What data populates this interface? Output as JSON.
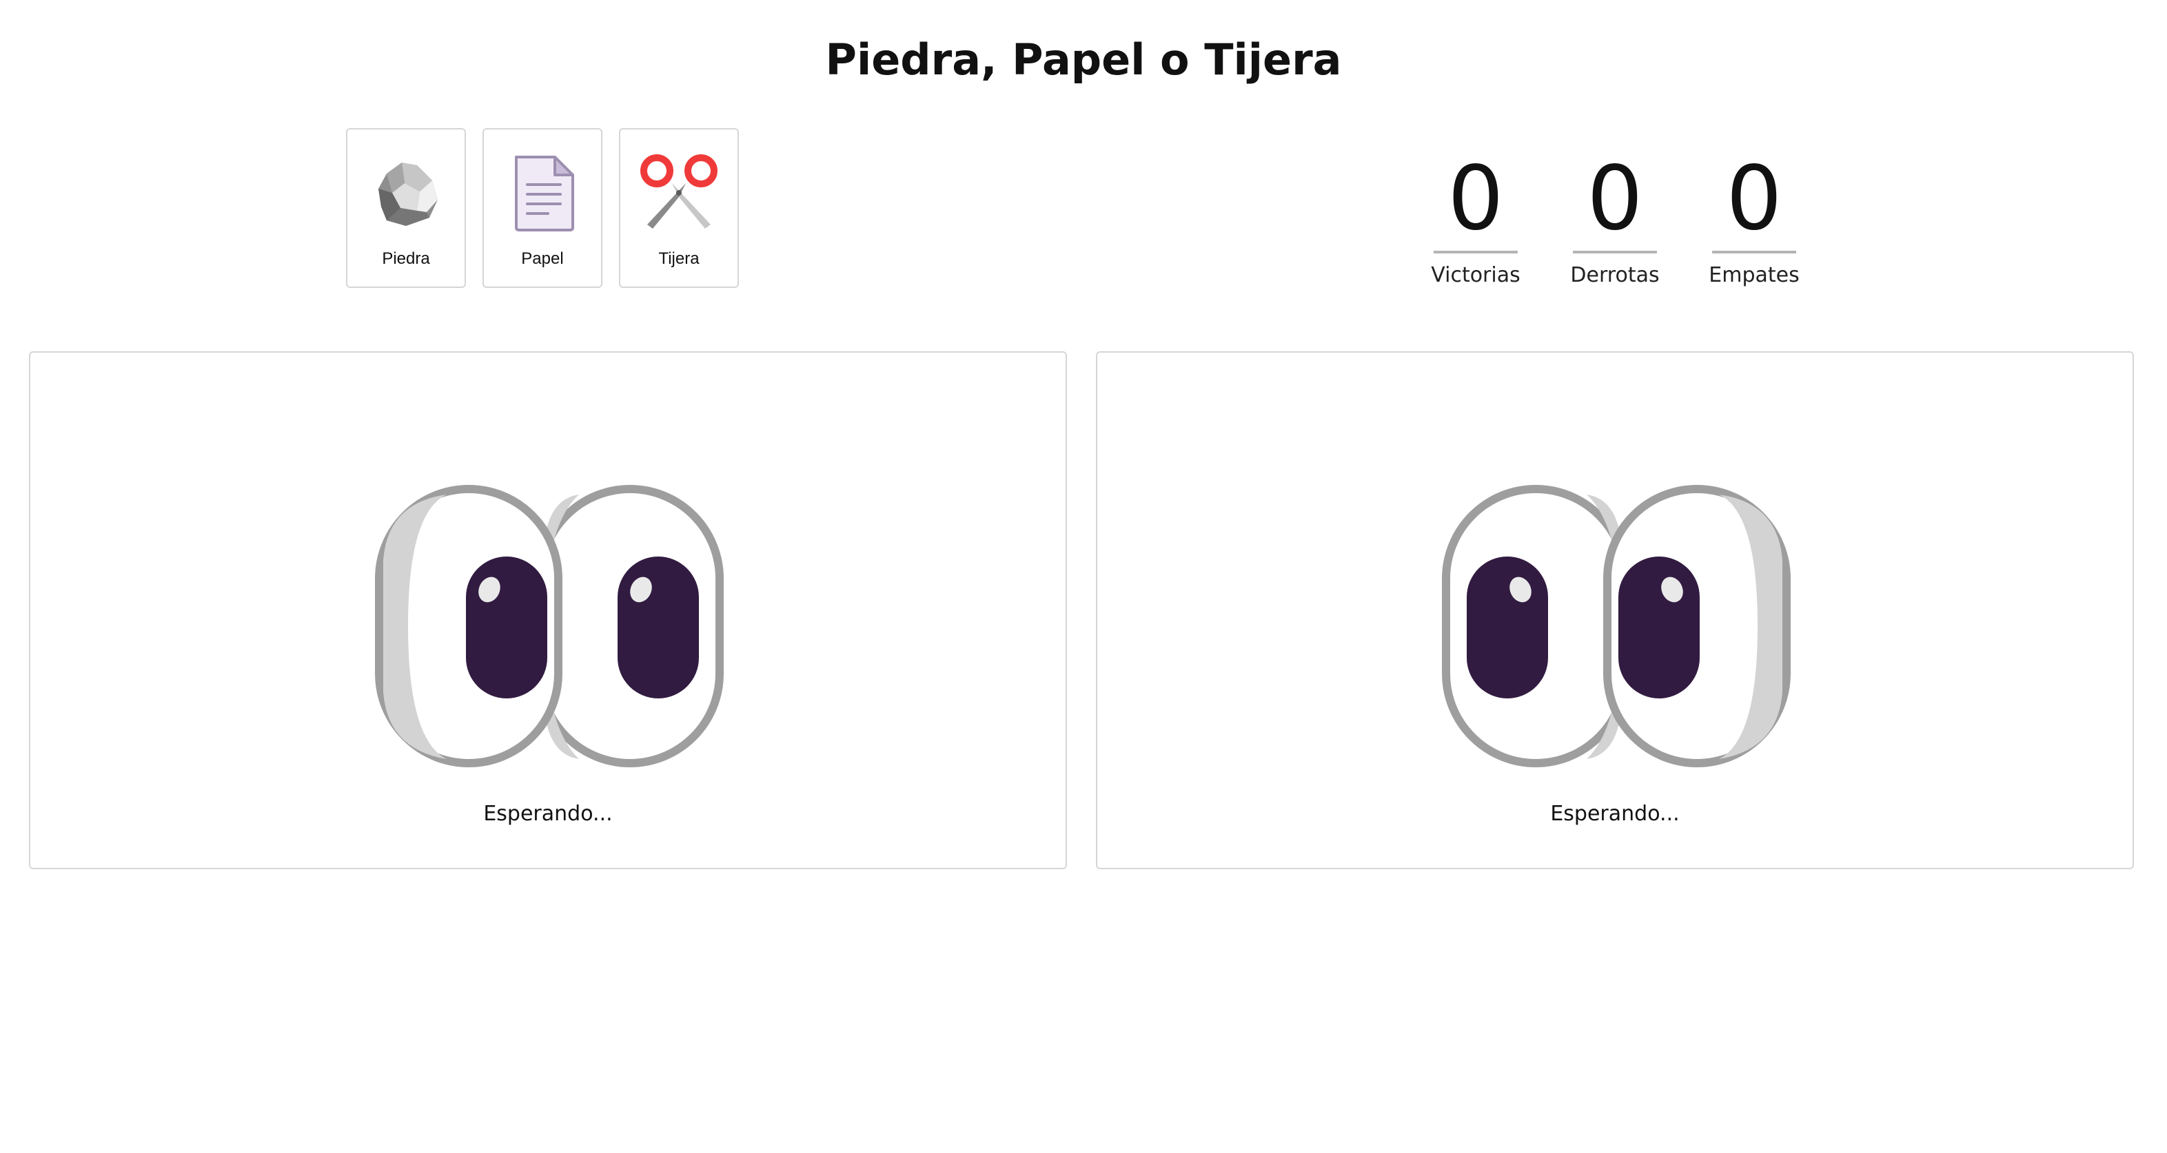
{
  "title": "Piedra, Papel o Tijera",
  "choices": [
    {
      "label": "Piedra",
      "icon": "rock-icon"
    },
    {
      "label": "Papel",
      "icon": "paper-icon"
    },
    {
      "label": "Tijera",
      "icon": "scissors-icon"
    }
  ],
  "scores": [
    {
      "value": "0",
      "label": "Victorias"
    },
    {
      "value": "0",
      "label": "Derrotas"
    },
    {
      "value": "0",
      "label": "Empates"
    }
  ],
  "panels": [
    {
      "status": "Esperando...",
      "icon": "eyes-icon"
    },
    {
      "status": "Esperando...",
      "icon": "eyes-icon"
    }
  ],
  "colors": {
    "border": "#d6d6d6",
    "score_rule": "#b4b4b4",
    "pupil": "#321b41",
    "scissors_handle": "#f03a3a"
  }
}
